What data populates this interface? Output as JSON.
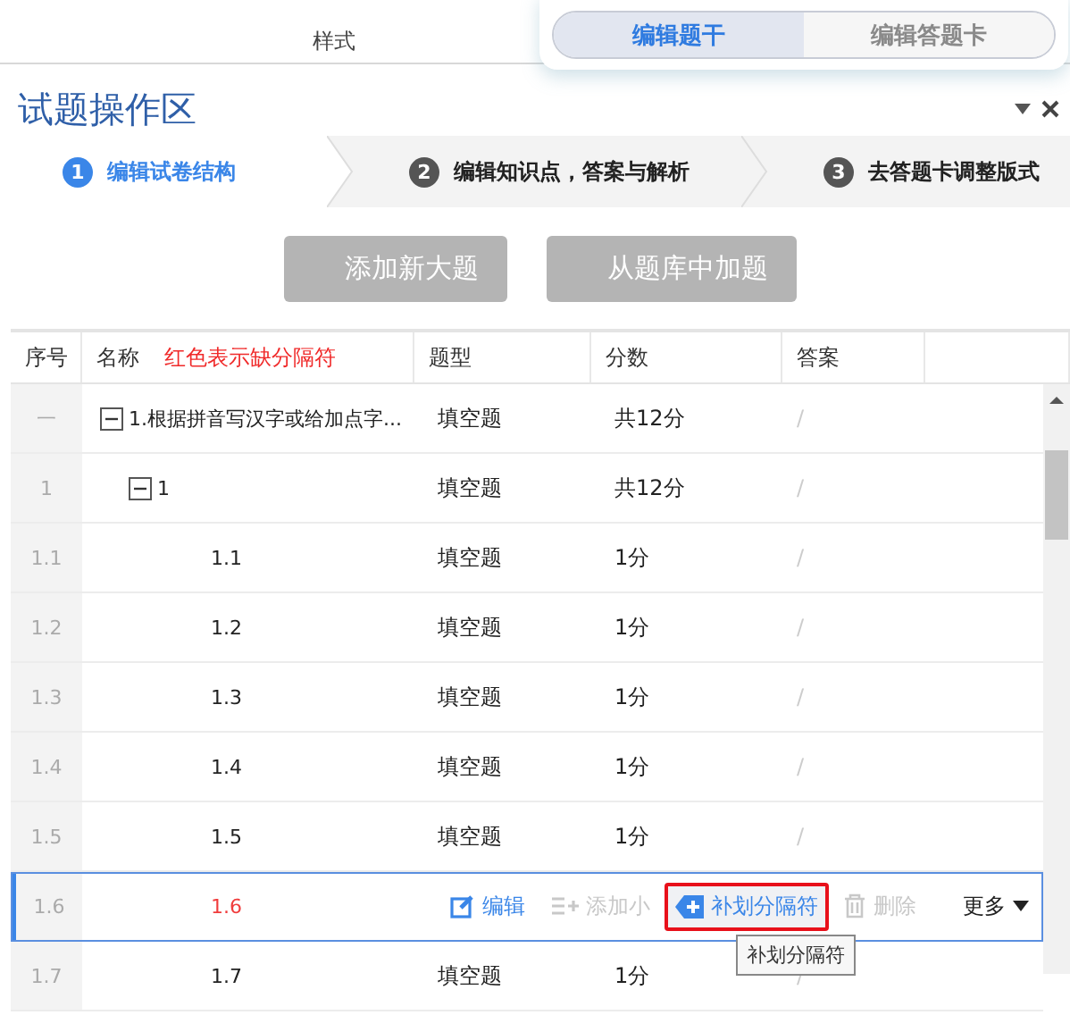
{
  "top": {
    "label": "样式"
  },
  "mode_toggle": [
    {
      "label": "编辑题干",
      "selected": true
    },
    {
      "label": "编辑答题卡",
      "selected": false
    }
  ],
  "panel": {
    "title": "试题操作区"
  },
  "steps": [
    {
      "number": "1",
      "label": "编辑试卷结构",
      "selected": true
    },
    {
      "number": "2",
      "label": "编辑知识点，答案与解析",
      "selected": false
    },
    {
      "number": "3",
      "label": "去答题卡调整版式",
      "selected": false
    }
  ],
  "buttons": [
    {
      "label": "添加新大题",
      "disabled": true
    },
    {
      "label": "从题库中加题",
      "disabled": true
    }
  ],
  "table": {
    "columns": [
      "序号",
      "名称",
      "题型",
      "分数",
      "答案"
    ],
    "hint": "红色表示缺分隔符",
    "rows": [
      {
        "index": "一",
        "name": "1.根据拼音写汉字或给加点字...",
        "type": "填空题",
        "score": "共12分",
        "answer": "/",
        "expanded": true,
        "children": [
          {
            "index": "1",
            "name": "1",
            "type": "填空题",
            "score": "共12分",
            "answer": "/",
            "expanded": true,
            "children": [
              {
                "index": "1.1",
                "name": "1.1",
                "type": "填空题",
                "score": "1分",
                "answer": "/",
                "missing_separator": false
              },
              {
                "index": "1.2",
                "name": "1.2",
                "type": "填空题",
                "score": "1分",
                "answer": "/",
                "missing_separator": false
              },
              {
                "index": "1.3",
                "name": "1.3",
                "type": "填空题",
                "score": "1分",
                "answer": "/",
                "missing_separator": false
              },
              {
                "index": "1.4",
                "name": "1.4",
                "type": "填空题",
                "score": "1分",
                "answer": "/",
                "missing_separator": false
              },
              {
                "index": "1.5",
                "name": "1.5",
                "type": "填空题",
                "score": "1分",
                "answer": "/",
                "missing_separator": false
              },
              {
                "index": "1.6",
                "name": "1.6",
                "missing_separator": true,
                "hovered": true,
                "actions": [
                  {
                    "kind": "edit",
                    "label": "编辑",
                    "disabled": false,
                    "highlighted": false
                  },
                  {
                    "kind": "add",
                    "label": "添加小",
                    "disabled": true,
                    "highlighted": false
                  },
                  {
                    "kind": "separator",
                    "label": "补划分隔符",
                    "disabled": false,
                    "highlighted": true
                  },
                  {
                    "kind": "delete",
                    "label": "删除",
                    "disabled": true,
                    "highlighted": false
                  },
                  {
                    "kind": "more",
                    "label": "更多"
                  }
                ]
              },
              {
                "index": "1.7",
                "name": "1.7",
                "type": "填空题",
                "score": "1分",
                "answer": "/",
                "missing_separator": false
              }
            ]
          }
        ]
      }
    ]
  },
  "tooltip": "补划分隔符"
}
